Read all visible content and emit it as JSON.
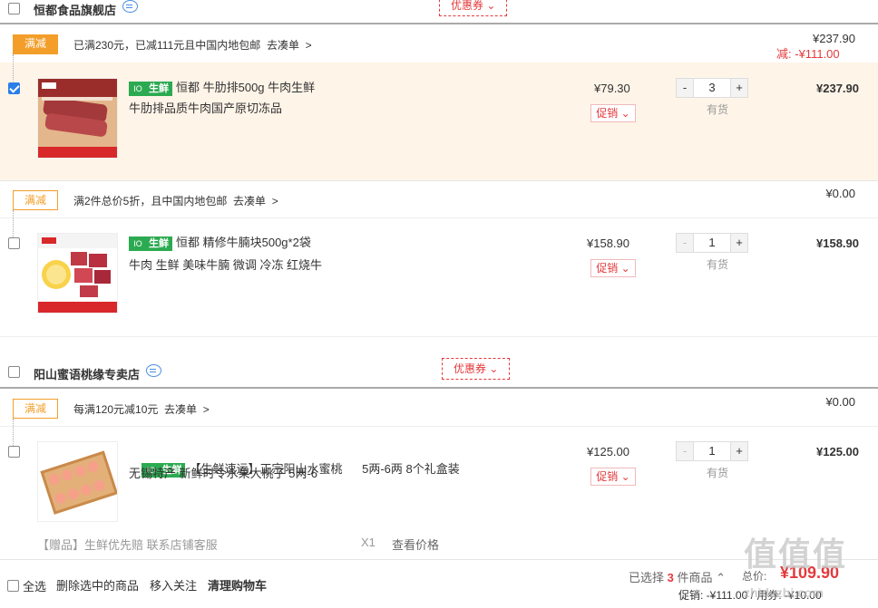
{
  "shop1": {
    "name": "恒都食品旗舰店",
    "coupon": "优惠券"
  },
  "group1": {
    "tag": "满减",
    "promo": "已满230元，已减111元且中国内地包邮",
    "link": "去凑单",
    "arrow": ">",
    "total": "¥237.90",
    "reduce_label": "减:",
    "reduce": "-¥111.00"
  },
  "item1": {
    "fresh_a": "IO",
    "fresh_b": "生鲜",
    "title1": "恒都 牛肋排500g 牛肉生鲜",
    "title2": "牛肋排品质牛肉国产原切冻品",
    "price": "¥79.30",
    "promo": "促销",
    "minus": "-",
    "qty": "3",
    "plus": "+",
    "stock": "有货",
    "sum": "¥237.90",
    "checked": true
  },
  "group2": {
    "tag": "满减",
    "promo": "满2件总价5折，且中国内地包邮",
    "link": "去凑单",
    "arrow": ">",
    "total": "¥0.00"
  },
  "item2": {
    "fresh_a": "IO",
    "fresh_b": "生鲜",
    "title1": "恒都 精修牛腩块500g*2袋",
    "title2": "牛肉 生鲜 美味牛腩 微调 冷冻 红烧牛",
    "price": "¥158.90",
    "promo": "促销",
    "minus": "-",
    "qty": "1",
    "plus": "+",
    "stock": "有货",
    "sum": "¥158.90",
    "checked": false
  },
  "shop2": {
    "name": "阳山蜜语桃缘专卖店",
    "coupon": "优惠券"
  },
  "group3": {
    "tag": "满减",
    "promo": "每满120元减10元",
    "link": "去凑单",
    "arrow": ">",
    "total": "¥0.00"
  },
  "item3": {
    "fresh_a": "IO",
    "fresh_b": "生鲜",
    "title1": "【生鲜速运】正宗阳山水蜜桃      5两-6两 8个礼盒装",
    "title2": "无锡特产 新鲜时令水果大桃子 5两-6",
    "price": "¥125.00",
    "promo": "促销",
    "minus": "-",
    "qty": "1",
    "plus": "+",
    "stock": "有货",
    "sum": "¥125.00",
    "checked": false
  },
  "gift": {
    "text": "【赠品】生鲜优先赔 联系店铺客服",
    "count": "X1",
    "check": "查看价格"
  },
  "bottom": {
    "select_all": "全选",
    "delete": "删除选中的商品",
    "follow": "移入关注",
    "clear": "清理购物车",
    "selected_pre": "已选择",
    "selected_count": "3",
    "selected_post": "件商品",
    "total_label": "总价:",
    "total": "¥109.90",
    "promo_line": "促销: -¥111.00 / 用券: -¥10.00"
  },
  "watermark": "值值值",
  "watermark_url": "zhidezhi.com"
}
